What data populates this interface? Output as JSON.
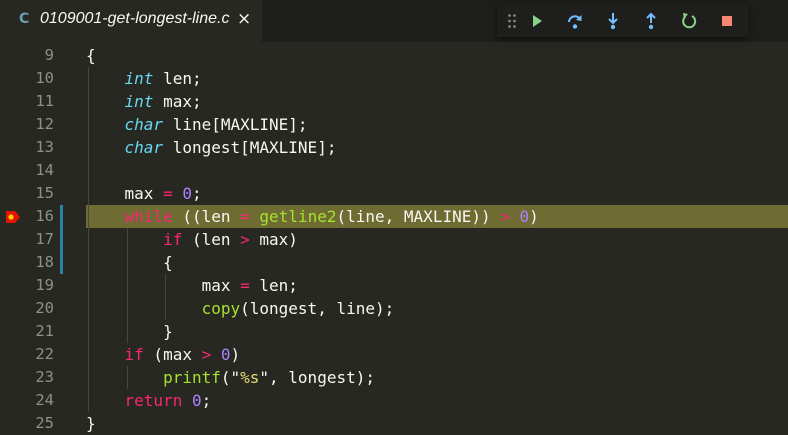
{
  "tab": {
    "lang": "C",
    "title": "0109001-get-longest-line.c",
    "close": "×"
  },
  "debug_toolbar": {
    "buttons": [
      {
        "name": "drag-handle",
        "icon": "grip-icon"
      },
      {
        "name": "continue-button",
        "icon": "play-icon",
        "color": "#89d185"
      },
      {
        "name": "step-over-button",
        "icon": "step-over-icon",
        "color": "#75beff"
      },
      {
        "name": "step-into-button",
        "icon": "step-into-icon",
        "color": "#75beff"
      },
      {
        "name": "step-out-button",
        "icon": "step-out-icon",
        "color": "#75beff"
      },
      {
        "name": "restart-button",
        "icon": "restart-icon",
        "color": "#89d185"
      },
      {
        "name": "stop-button",
        "icon": "stop-icon",
        "color": "#f48771"
      }
    ]
  },
  "editor": {
    "current_line": 16,
    "breakpoint_line": 16,
    "lines": [
      {
        "num": "9",
        "tokens": [
          [
            "p",
            "{"
          ]
        ]
      },
      {
        "num": "10",
        "tokens": [
          [
            "p",
            "    "
          ],
          [
            "ty",
            "int"
          ],
          [
            "p",
            " len;"
          ]
        ]
      },
      {
        "num": "11",
        "tokens": [
          [
            "p",
            "    "
          ],
          [
            "ty",
            "int"
          ],
          [
            "p",
            " max;"
          ]
        ]
      },
      {
        "num": "12",
        "tokens": [
          [
            "p",
            "    "
          ],
          [
            "ty",
            "char"
          ],
          [
            "p",
            " line[MAXLINE];"
          ]
        ]
      },
      {
        "num": "13",
        "tokens": [
          [
            "p",
            "    "
          ],
          [
            "ty",
            "char"
          ],
          [
            "p",
            " longest[MAXLINE];"
          ]
        ]
      },
      {
        "num": "14",
        "tokens": []
      },
      {
        "num": "15",
        "tokens": [
          [
            "p",
            "    max "
          ],
          [
            "op",
            "="
          ],
          [
            "p",
            " "
          ],
          [
            "num",
            "0"
          ],
          [
            "p",
            ";"
          ]
        ]
      },
      {
        "num": "16",
        "tokens": [
          [
            "p",
            "    "
          ],
          [
            "kw",
            "while"
          ],
          [
            "p",
            " ((len "
          ],
          [
            "op",
            "="
          ],
          [
            "p",
            " "
          ],
          [
            "fn",
            "getline2"
          ],
          [
            "p",
            "(line, MAXLINE)) "
          ],
          [
            "op",
            ">"
          ],
          [
            "p",
            " "
          ],
          [
            "num",
            "0"
          ],
          [
            "p",
            ")"
          ]
        ]
      },
      {
        "num": "17",
        "tokens": [
          [
            "p",
            "        "
          ],
          [
            "kw",
            "if"
          ],
          [
            "p",
            " (len "
          ],
          [
            "op",
            ">"
          ],
          [
            "p",
            " max)"
          ]
        ]
      },
      {
        "num": "18",
        "tokens": [
          [
            "p",
            "        {"
          ]
        ]
      },
      {
        "num": "19",
        "tokens": [
          [
            "p",
            "            max "
          ],
          [
            "op",
            "="
          ],
          [
            "p",
            " len;"
          ]
        ]
      },
      {
        "num": "20",
        "tokens": [
          [
            "p",
            "            "
          ],
          [
            "fn",
            "copy"
          ],
          [
            "p",
            "(longest, line);"
          ]
        ]
      },
      {
        "num": "21",
        "tokens": [
          [
            "p",
            "        }"
          ]
        ]
      },
      {
        "num": "22",
        "tokens": [
          [
            "p",
            "    "
          ],
          [
            "kw",
            "if"
          ],
          [
            "p",
            " (max "
          ],
          [
            "op",
            ">"
          ],
          [
            "p",
            " "
          ],
          [
            "num",
            "0"
          ],
          [
            "p",
            ")"
          ]
        ]
      },
      {
        "num": "23",
        "tokens": [
          [
            "p",
            "        "
          ],
          [
            "fn",
            "printf"
          ],
          [
            "p",
            "(\""
          ],
          [
            "str",
            "%s"
          ],
          [
            "p",
            "\", longest);"
          ]
        ]
      },
      {
        "num": "24",
        "tokens": [
          [
            "p",
            "    "
          ],
          [
            "kw",
            "return"
          ],
          [
            "p",
            " "
          ],
          [
            "num",
            "0"
          ],
          [
            "p",
            ";"
          ]
        ]
      },
      {
        "num": "25",
        "tokens": [
          [
            "p",
            "}"
          ]
        ]
      }
    ]
  },
  "colors": {
    "background": "#272822",
    "line_highlight": "#6e6c32",
    "breakpoint": "#e51400",
    "git_modified": "#2a83a7"
  }
}
